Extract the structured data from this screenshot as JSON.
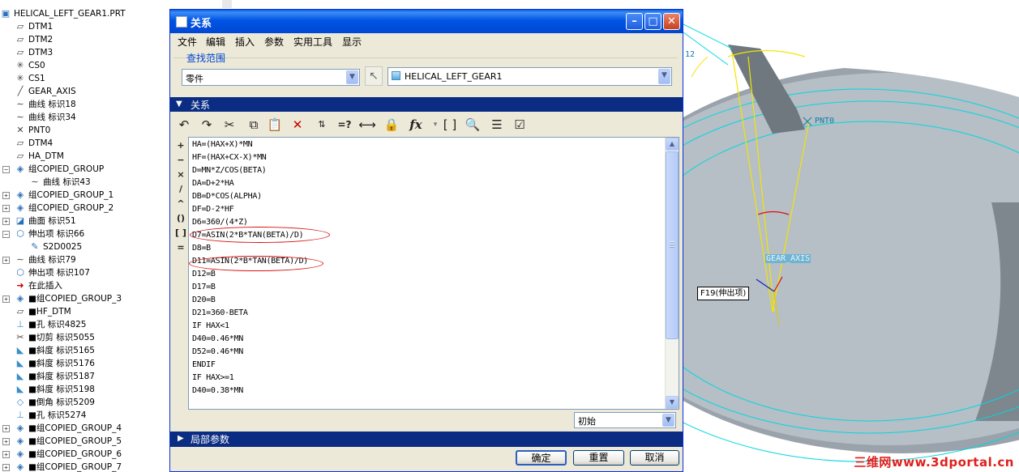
{
  "model_tree": {
    "items": [
      {
        "label": "HELICAL_LEFT_GEAR1.PRT",
        "icon": "part-icon",
        "expander": ""
      },
      {
        "label": "DTM1",
        "icon": "datum-plane-icon",
        "expander": ""
      },
      {
        "label": "DTM2",
        "icon": "datum-plane-icon",
        "expander": ""
      },
      {
        "label": "DTM3",
        "icon": "datum-plane-icon",
        "expander": ""
      },
      {
        "label": "CS0",
        "icon": "coord-system-icon",
        "expander": ""
      },
      {
        "label": "CS1",
        "icon": "coord-system-icon",
        "expander": ""
      },
      {
        "label": "GEAR_AXIS",
        "icon": "axis-icon",
        "expander": ""
      },
      {
        "label": "曲线 标识18",
        "icon": "curve-icon",
        "expander": ""
      },
      {
        "label": "曲线 标识34",
        "icon": "curve-icon",
        "expander": ""
      },
      {
        "label": "PNT0",
        "icon": "datum-point-icon",
        "expander": ""
      },
      {
        "label": "DTM4",
        "icon": "datum-plane-icon",
        "expander": ""
      },
      {
        "label": "HA_DTM",
        "icon": "datum-plane-icon",
        "expander": ""
      },
      {
        "label": "组COPIED_GROUP",
        "icon": "group-icon",
        "expander": "−"
      },
      {
        "label": "曲线 标识43",
        "icon": "curve-icon",
        "expander": ""
      },
      {
        "label": "组COPIED_GROUP_1",
        "icon": "group-icon",
        "expander": "+"
      },
      {
        "label": "组COPIED_GROUP_2",
        "icon": "group-icon",
        "expander": "+"
      },
      {
        "label": "曲面 标识51",
        "icon": "surface-icon",
        "expander": "+"
      },
      {
        "label": "伸出项 标识66",
        "icon": "protrusion-icon",
        "expander": "−"
      },
      {
        "label": "S2D0025",
        "icon": "sketch-icon",
        "expander": ""
      },
      {
        "label": "曲线 标识79",
        "icon": "curve-icon",
        "expander": "+"
      },
      {
        "label": "伸出项 标识107",
        "icon": "protrusion-icon",
        "expander": ""
      },
      {
        "label": "在此插入",
        "icon": "insert-here-icon",
        "expander": ""
      },
      {
        "label": "■组COPIED_GROUP_3",
        "icon": "group-icon",
        "expander": "+"
      },
      {
        "label": "■HF_DTM",
        "icon": "datum-plane-icon",
        "expander": ""
      },
      {
        "label": "■孔 标识4825",
        "icon": "hole-icon",
        "expander": ""
      },
      {
        "label": "■切剪 标识5055",
        "icon": "cut-icon",
        "expander": ""
      },
      {
        "label": "■斜度 标识5165",
        "icon": "draft-icon",
        "expander": ""
      },
      {
        "label": "■斜度 标识5176",
        "icon": "draft-icon",
        "expander": ""
      },
      {
        "label": "■斜度 标识5187",
        "icon": "draft-icon",
        "expander": ""
      },
      {
        "label": "■斜度 标识5198",
        "icon": "draft-icon",
        "expander": ""
      },
      {
        "label": "■倒角 标识5209",
        "icon": "chamfer-icon",
        "expander": ""
      },
      {
        "label": "■孔 标识5274",
        "icon": "hole-icon",
        "expander": ""
      },
      {
        "label": "■组COPIED_GROUP_4",
        "icon": "group-icon",
        "expander": "+"
      },
      {
        "label": "■组COPIED_GROUP_5",
        "icon": "group-icon",
        "expander": "+"
      },
      {
        "label": "■组COPIED_GROUP_6",
        "icon": "group-icon",
        "expander": "+"
      },
      {
        "label": "■组COPIED_GROUP_7",
        "icon": "group-icon",
        "expander": "+"
      }
    ]
  },
  "dialog": {
    "title": "关系",
    "menu": [
      "文件",
      "编辑",
      "插入",
      "参数",
      "实用工具",
      "显示"
    ],
    "scope": {
      "label": "查找范围",
      "type_value": "零件",
      "model_value": "HELICAL_LEFT_GEAR1"
    },
    "relations_header": "关系",
    "toolbar": [
      "undo-icon",
      "redo-icon",
      "cut-icon",
      "copy-icon",
      "paste-icon",
      "delete-icon",
      "sort-relations-icon",
      "evaluate-icon",
      "dimension-icon",
      "lock-icon",
      "function-icon",
      "parentheses-icon",
      "verify-icon",
      "show-relations-icon",
      "checkbox-icon"
    ],
    "toolbar_labels": {
      "function": "fx",
      "evaluate": "=?",
      "brackets": "[ ]"
    },
    "operators": [
      "+",
      "−",
      "×",
      "/",
      "^",
      "()",
      "[ ]",
      "="
    ],
    "relations": [
      "HA=(HAX+X)*MN",
      "HF=(HAX+CX-X)*MN",
      "D=MN*Z/COS(BETA)",
      "DA=D+2*HA",
      "DB=D*COS(ALPHA)",
      "DF=D-2*HF",
      "D6=360/(4*Z)",
      "D7=ASIN(2*B*TAN(BETA)/D)",
      "D8=B",
      "D11=ASIN(2*B*TAN(BETA)/D)",
      "D12=B",
      "D17=B",
      "D20=B",
      "D21=360-BETA",
      "IF HAX<1",
      "D40=0.46*MN",
      "D52=0.46*MN",
      "ENDIF",
      "IF HAX>=1",
      "D40=0.38*MN"
    ],
    "units_value": "初始",
    "local_params_header": "局部参数",
    "buttons": {
      "ok": "确定",
      "reset": "重置",
      "cancel": "取消"
    }
  },
  "graphics": {
    "tags": {
      "pnt0": "PNT0",
      "gear_axis": "GEAR_AXIS",
      "feature": "F19(伸出项)"
    },
    "dim_label": "12",
    "watermark": "三维网www.3dportal.cn"
  },
  "colors": {
    "title_blue": "#0055e5",
    "section_blue": "#0a2c82",
    "scope_label": "#0046d5",
    "annotation_red": "#d81010"
  }
}
